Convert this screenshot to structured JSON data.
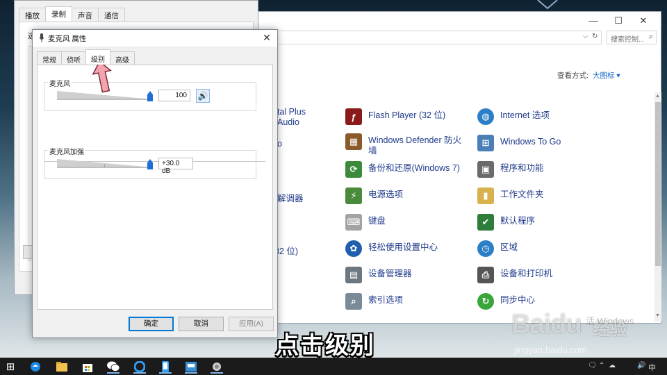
{
  "control_panel": {
    "window_controls": {
      "minimize": "—",
      "maximize": "☐",
      "close": "✕"
    },
    "address_dropdown": "⌵",
    "address_refresh": "↻",
    "search_placeholder": "搜索控制...",
    "view_by_label": "查看方式:",
    "view_by_value": "大图标 ▾",
    "left_fragments": [
      "tal Plus",
      "Audio",
      "o",
      "解调器",
      "32 位)"
    ],
    "middle_items": [
      {
        "label": "Flash Player (32 位)",
        "icon": "flash-icon",
        "color": "#8b1a1a"
      },
      {
        "label": "Windows Defender 防火墙",
        "icon": "firewall-icon",
        "color": "#8a5a2a"
      },
      {
        "label": "备份和还原(Windows 7)",
        "icon": "backup-icon",
        "color": "#3c8b3c"
      },
      {
        "label": "电源选项",
        "icon": "power-icon",
        "color": "#4a8a3a"
      },
      {
        "label": "键盘",
        "icon": "keyboard-icon",
        "color": "#8a8a8a"
      },
      {
        "label": "轻松使用设置中心",
        "icon": "ease-of-access-icon",
        "color": "#1f5fae"
      },
      {
        "label": "设备管理器",
        "icon": "device-manager-icon",
        "color": "#6d7780"
      },
      {
        "label": "索引选项",
        "icon": "indexing-icon",
        "color": "#7b8a99"
      }
    ],
    "right_items": [
      {
        "label": "Internet 选项",
        "icon": "internet-options-icon",
        "color": "#2a7fc6"
      },
      {
        "label": "Windows To Go",
        "icon": "windows-to-go-icon",
        "color": "#4a7fb8"
      },
      {
        "label": "程序和功能",
        "icon": "programs-icon",
        "color": "#6a6a6a"
      },
      {
        "label": "工作文件夹",
        "icon": "work-folders-icon",
        "color": "#d9b250"
      },
      {
        "label": "默认程序",
        "icon": "default-programs-icon",
        "color": "#2f7d3a"
      },
      {
        "label": "区域",
        "icon": "region-icon",
        "color": "#2a7fc6"
      },
      {
        "label": "设备和打印机",
        "icon": "printer-icon",
        "color": "#555"
      },
      {
        "label": "同步中心",
        "icon": "sync-center-icon",
        "color": "#3aa53a"
      }
    ]
  },
  "recording_window": {
    "tabs": [
      "播放",
      "录制",
      "声音",
      "通信"
    ],
    "active_tab": 1,
    "select_text": "选"
  },
  "dialog": {
    "title": "麦克风 属性",
    "close": "✕",
    "tabs": [
      "常规",
      "侦听",
      "级别",
      "高级"
    ],
    "active_tab": 2,
    "microphone": {
      "label": "麦克风",
      "value": "100",
      "level": 1.0
    },
    "boost": {
      "label": "麦克风加强",
      "value": "+30.0 dB",
      "level": 1.0
    },
    "speaker_glyph": "🔊",
    "buttons": {
      "ok": "确定",
      "cancel": "取消",
      "apply": "应用(A)"
    }
  },
  "caption": "点击级别",
  "watermark": {
    "brand": "Baidu",
    "sub": "经验",
    "url": "jingyan.baidu.com"
  },
  "desktop_ghost_text": "活 Windows",
  "taskbar": {
    "start_glyph": "⊞",
    "ime": "中",
    "tray_glyphs": [
      "🗨",
      "⌃",
      "☁",
      "🔊"
    ],
    "icons": [
      "start-icon",
      "edge-icon",
      "file-explorer-icon",
      "store-icon",
      "wechat-icon",
      "browser-icon",
      "phone-icon",
      "app-icon",
      "camera-icon"
    ]
  }
}
